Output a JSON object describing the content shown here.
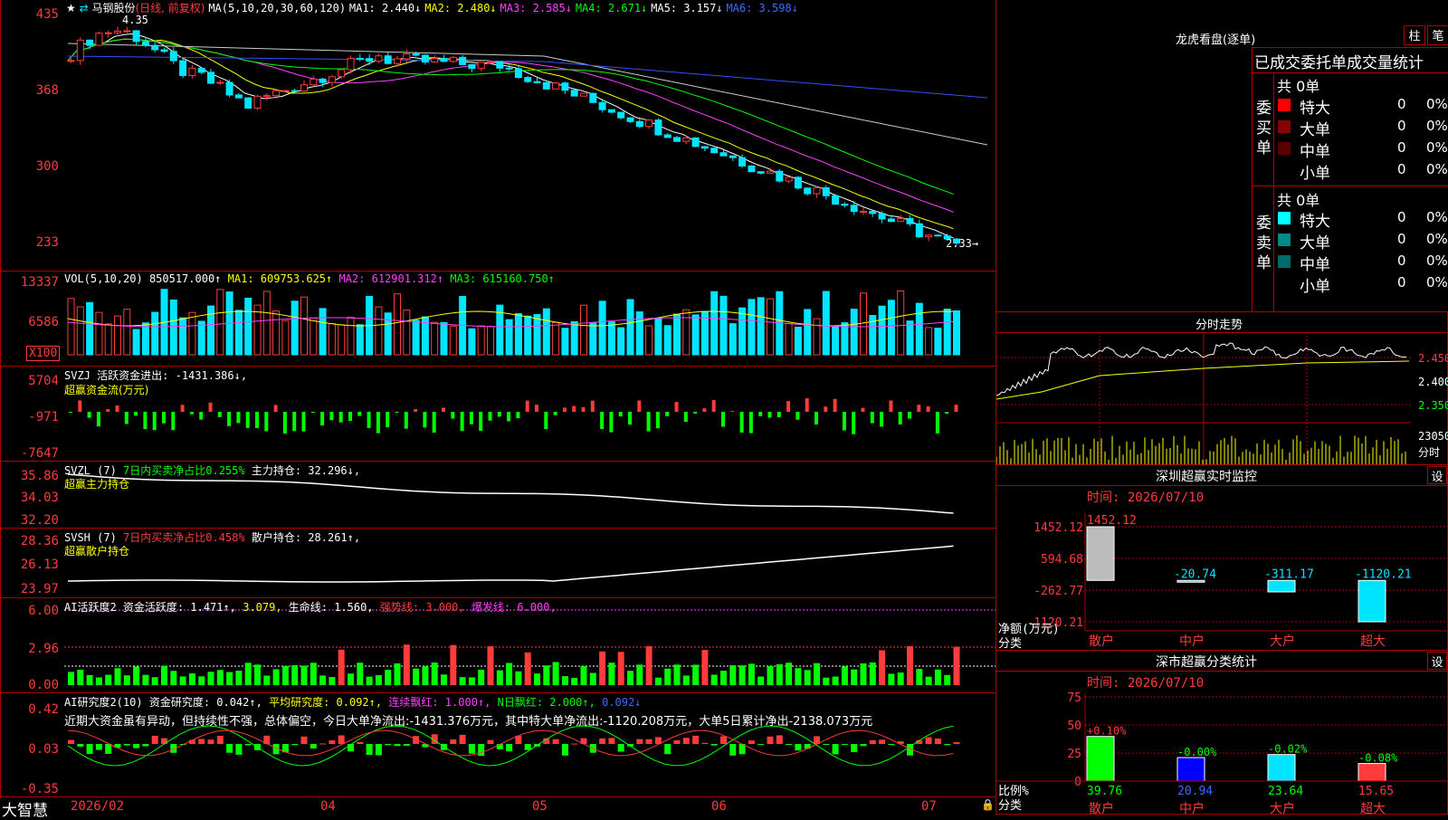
{
  "main": {
    "stock_name": "马钢股份",
    "mode": "(日线, 前复权)",
    "ma_title": "MA(5,10,20,30,60,120)",
    "ma1": "MA1: 2.440↓",
    "ma2": "MA2: 2.480↓",
    "ma3": "MA3: 2.585↓",
    "ma4": "MA4: 2.671↓",
    "ma5": "MA5: 3.157↓",
    "ma6": "MA6: 3.598↓",
    "high_mark": "4.35",
    "low_mark": "2.33→",
    "yaxis": [
      "435",
      "368",
      "300",
      "233"
    ]
  },
  "vol": {
    "title": "VOL(5,10,20)",
    "value": "850517.000↑",
    "ma1": "MA1: 609753.625↑",
    "ma2": "MA2: 612901.312↑",
    "ma3": "MA3: 615160.750↑",
    "yaxis": [
      "13337",
      "6586"
    ],
    "unit": "X100"
  },
  "svzj": {
    "title": "SVZJ",
    "line1": "活跃资金进出: -1431.386↓,",
    "line2": "超赢资金流(万元)",
    "yaxis": [
      "5704",
      "-971",
      "-7647"
    ]
  },
  "svzl": {
    "title": "SVZL (7)",
    "ratio": "7日内买卖净占比0.255%",
    "hold": "主力持仓: 32.296↓,",
    "sub": "超赢主力持仓",
    "yaxis": [
      "35.86",
      "34.03",
      "32.20"
    ]
  },
  "svsh": {
    "title": "SVSH (7)",
    "ratio": "7日内买卖净占比0.458%",
    "hold": "散户持仓: 28.261↑,",
    "sub": "超赢散户持仓",
    "yaxis": [
      "28.36",
      "26.13",
      "23.97"
    ]
  },
  "ai_active": {
    "title": "AI活跃度2",
    "v1": "资金活跃度: 1.471↑,",
    "v2": "3.079,",
    "v3": "生命线: 1.560,",
    "v4": "强势线: 3.000,",
    "v5": "爆发线: 6.000,",
    "yaxis": [
      "6.00",
      "2.96",
      "0.00"
    ]
  },
  "ai_research": {
    "title": "AI研究度2(10)",
    "v1": "资金研究度: 0.042↑,",
    "v2": "平均研究度: 0.092↑,",
    "v3": "连续飘红: 1.000↑,",
    "v4": "N日飘红: 2.000↑,",
    "v5": "0.092↓",
    "comment": "近期大资金虽有异动，但持续性不强，总体偏空，今日大单净流出:-1431.376万元，其中特大单净流出:-1120.208万元，大单5日累计净出-2138.073万元",
    "yaxis": [
      "0.42",
      "0.03",
      "-0.35"
    ]
  },
  "bottom": {
    "brand": "大智慧",
    "dates": [
      "2026/02",
      "04",
      "05",
      "06",
      "07"
    ]
  },
  "dragon": {
    "title": "龙虎看盘(逐单)",
    "btn1": "柱",
    "btn2": "笔",
    "header": "已成交委托单成交量统计",
    "buy_label": "委买单",
    "sell_label": "委卖单",
    "buy_total": "共 0单",
    "sell_total": "共 0单",
    "buy_rows": [
      {
        "name": "特大",
        "count": "0",
        "pct": "0%",
        "color": "#ff0000"
      },
      {
        "name": "大单",
        "count": "0",
        "pct": "0%",
        "color": "#8b0000"
      },
      {
        "name": "中单",
        "count": "0",
        "pct": "0%",
        "color": "#5a0000"
      },
      {
        "name": "小单",
        "count": "0",
        "pct": "0%",
        "color": "#000000"
      }
    ],
    "sell_rows": [
      {
        "name": "特大",
        "count": "0",
        "pct": "0%",
        "color": "#00ffff"
      },
      {
        "name": "大单",
        "count": "0",
        "pct": "0%",
        "color": "#008b8b"
      },
      {
        "name": "中单",
        "count": "0",
        "pct": "0%",
        "color": "#006b6b"
      },
      {
        "name": "小单",
        "count": "0",
        "pct": "0%",
        "color": "#000000"
      }
    ]
  },
  "intraday": {
    "title": "分时走势",
    "yaxis": [
      "2.450",
      "2.400",
      "2.350"
    ],
    "vol_label": "23050",
    "vol_unit": "分时"
  },
  "sz_monitor": {
    "title": "深圳超赢实时监控",
    "btn": "设",
    "time": "时间: 2026/07/10",
    "yaxis": [
      "1452.12",
      "594.68",
      "-262.77",
      "-1120.21"
    ],
    "values": [
      "1452.12",
      "-20.74",
      "-311.17",
      "-1120.21"
    ],
    "categories": [
      "散户",
      "中户",
      "大户",
      "超大"
    ],
    "ylabel": "净额(万元)",
    "xlabel": "分类"
  },
  "sz_class": {
    "title": "深市超赢分类统计",
    "btn": "设",
    "time": "时间: 2026/07/10",
    "yaxis": [
      "75",
      "50",
      "25",
      "0"
    ],
    "changes": [
      "+0.10%",
      "-0.00%",
      "-0.02%",
      "-0.08%"
    ],
    "values": [
      "39.76",
      "20.94",
      "23.64",
      "15.65"
    ],
    "categories": [
      "散户",
      "中户",
      "大户",
      "超大"
    ],
    "ylabel": "比例%",
    "xlabel": "分类"
  },
  "colors": {
    "up": "#ff3b3b",
    "down": "#00e5ff",
    "grid": "#a00000"
  }
}
